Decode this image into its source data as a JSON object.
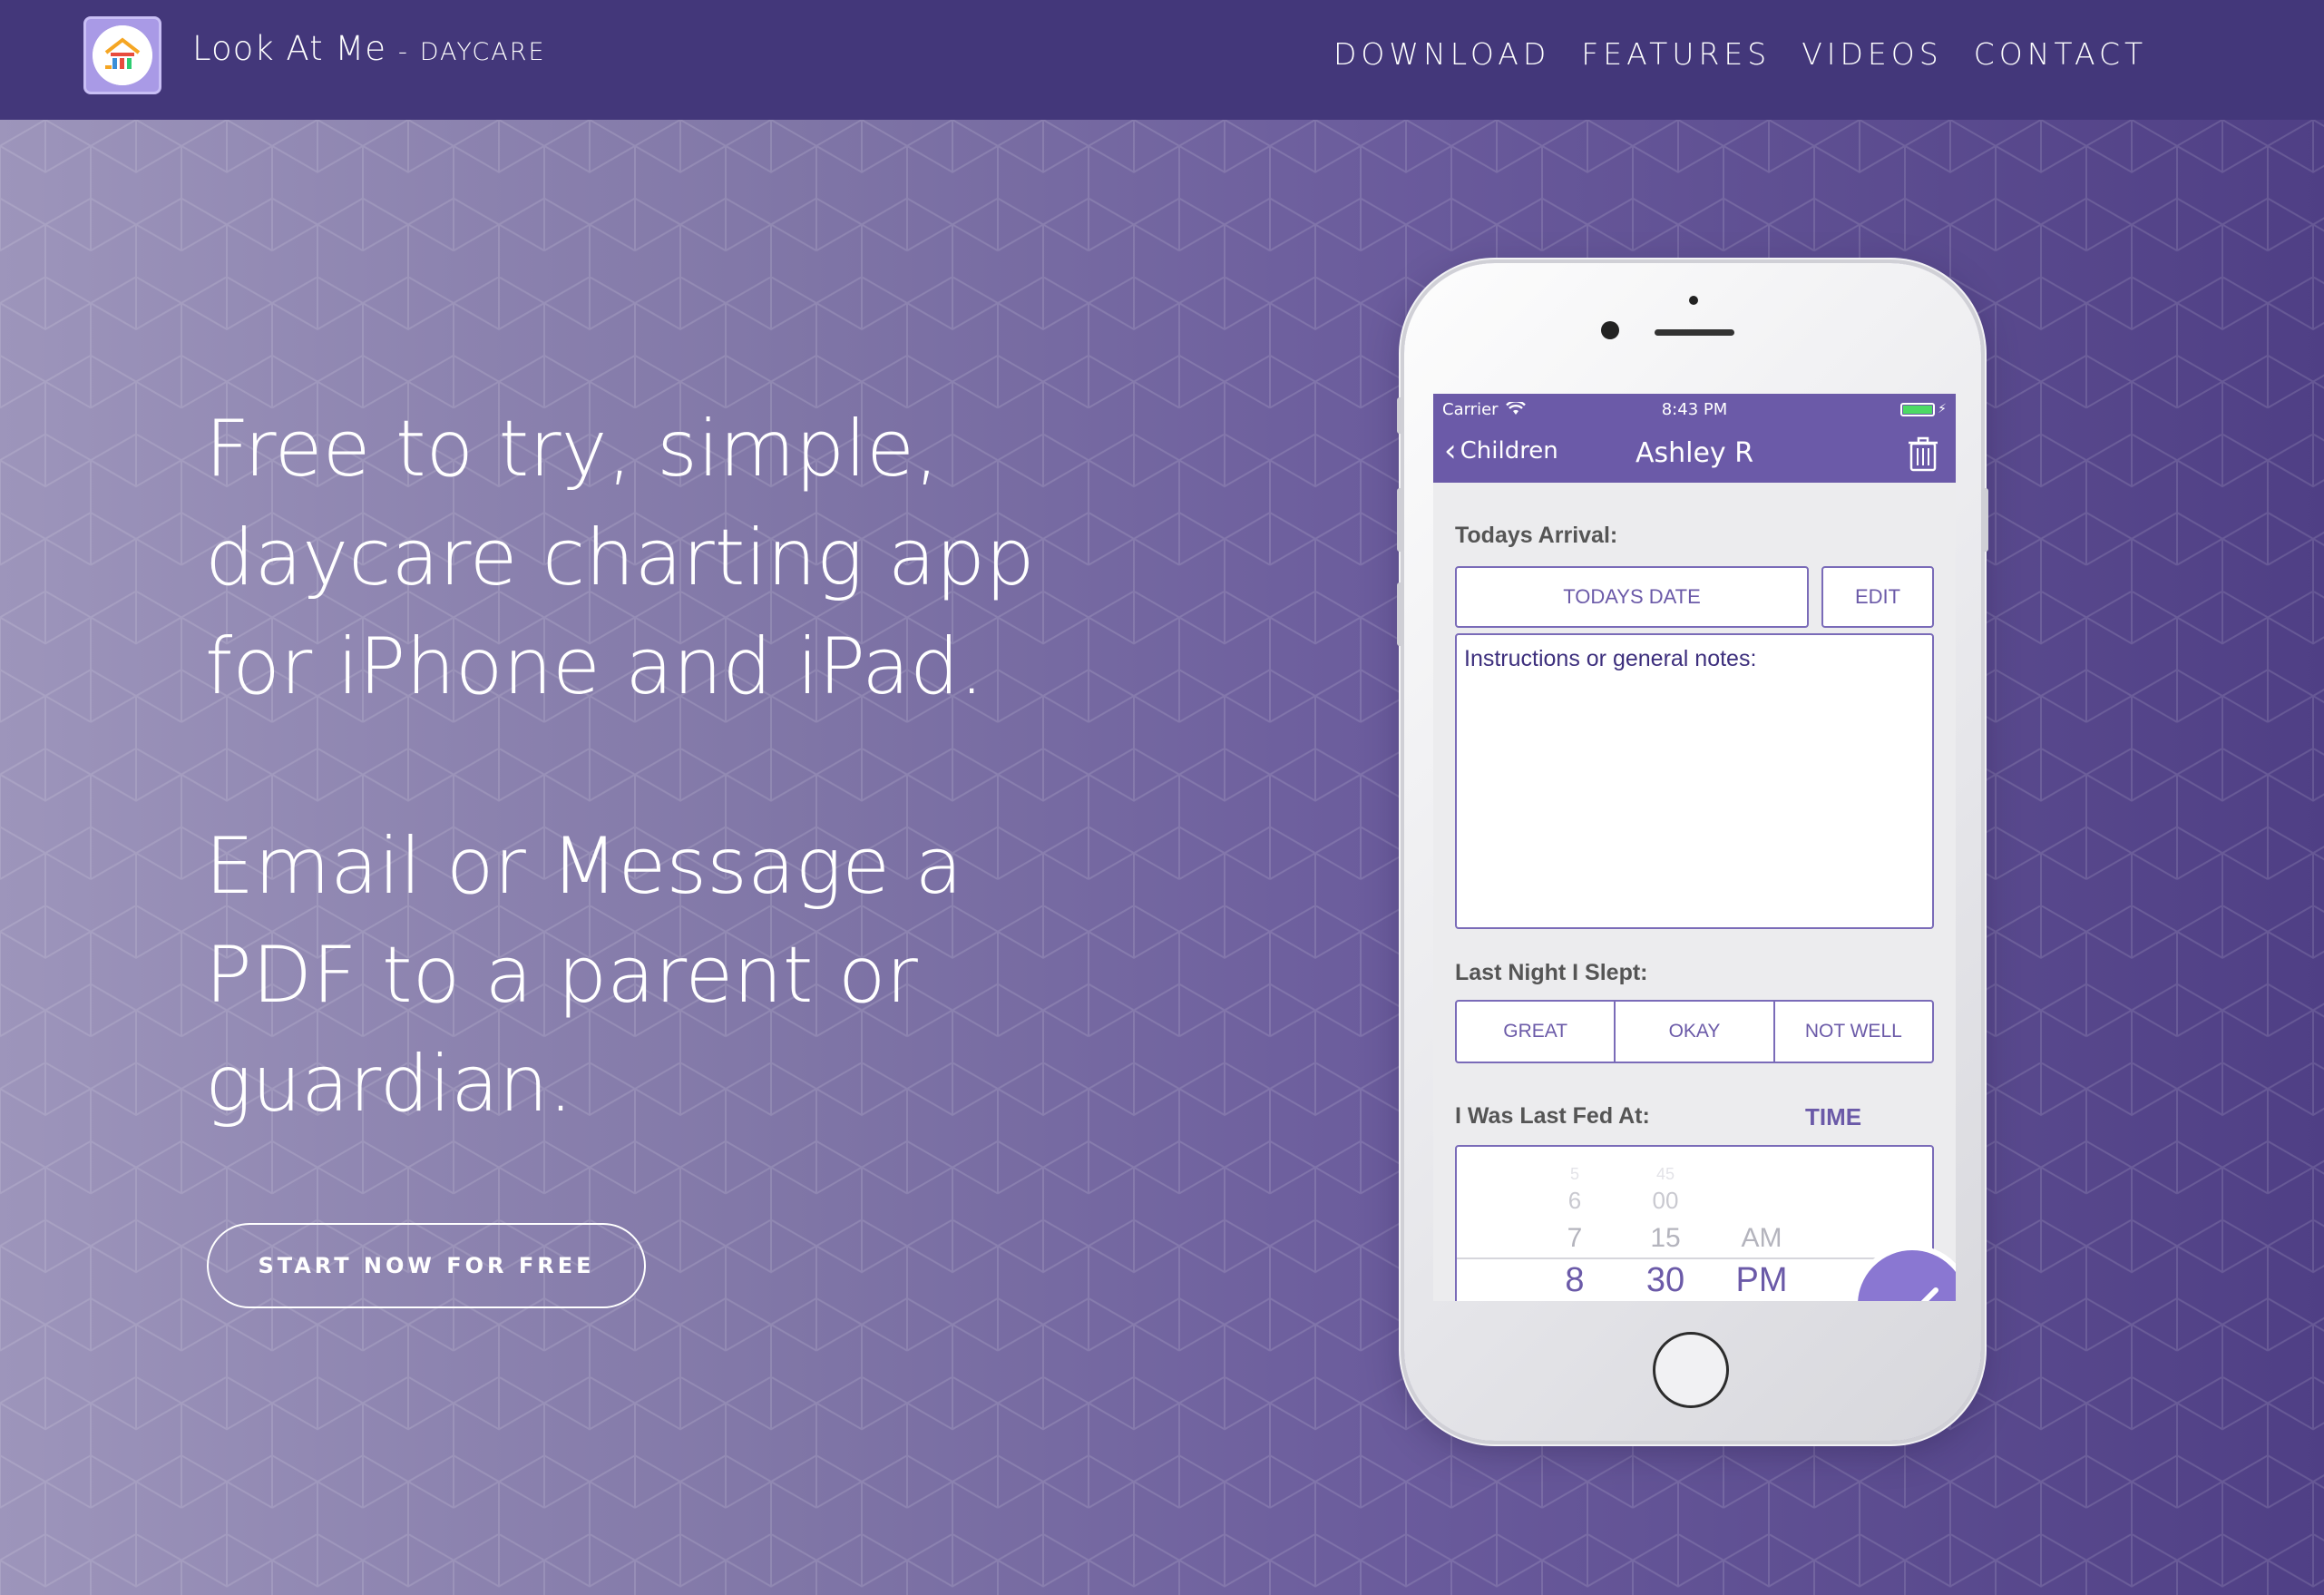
{
  "colors": {
    "nav_bg": "#43377a",
    "accent": "#6b5aa8",
    "app_bar": "#6b5aa8"
  },
  "header": {
    "brand_main": "Look At Me",
    "brand_dash": "-",
    "brand_sub": "DAYCARE",
    "nav": [
      "DOWNLOAD",
      "FEATURES",
      "VIDEOS",
      "CONTACT"
    ]
  },
  "hero": {
    "paragraph_1": [
      "Free to try, simple,",
      "daycare charting app",
      "for iPhone and iPad."
    ],
    "paragraph_2": [
      "Email or Message a",
      "PDF to a parent or",
      "guardian."
    ],
    "cta_label": "START NOW FOR FREE"
  },
  "phone": {
    "status": {
      "carrier": "Carrier",
      "time": "8:43 PM"
    },
    "navbar": {
      "back_label": "Children",
      "title": "Ashley R"
    },
    "arrival": {
      "label": "Todays Arrival:",
      "date_button": "TODAYS DATE",
      "edit_button": "EDIT"
    },
    "notes_placeholder": "Instructions or general notes:",
    "sleep": {
      "label": "Last Night I Slept:",
      "options": [
        "GREAT",
        "OKAY",
        "NOT WELL"
      ]
    },
    "fed": {
      "label": "I Was Last Fed At:",
      "time_link": "TIME"
    },
    "picker": {
      "hours": [
        "5",
        "6",
        "7",
        "8"
      ],
      "minutes": [
        "45",
        "00",
        "15",
        "30"
      ],
      "meridiem": [
        "AM",
        "PM"
      ]
    }
  }
}
